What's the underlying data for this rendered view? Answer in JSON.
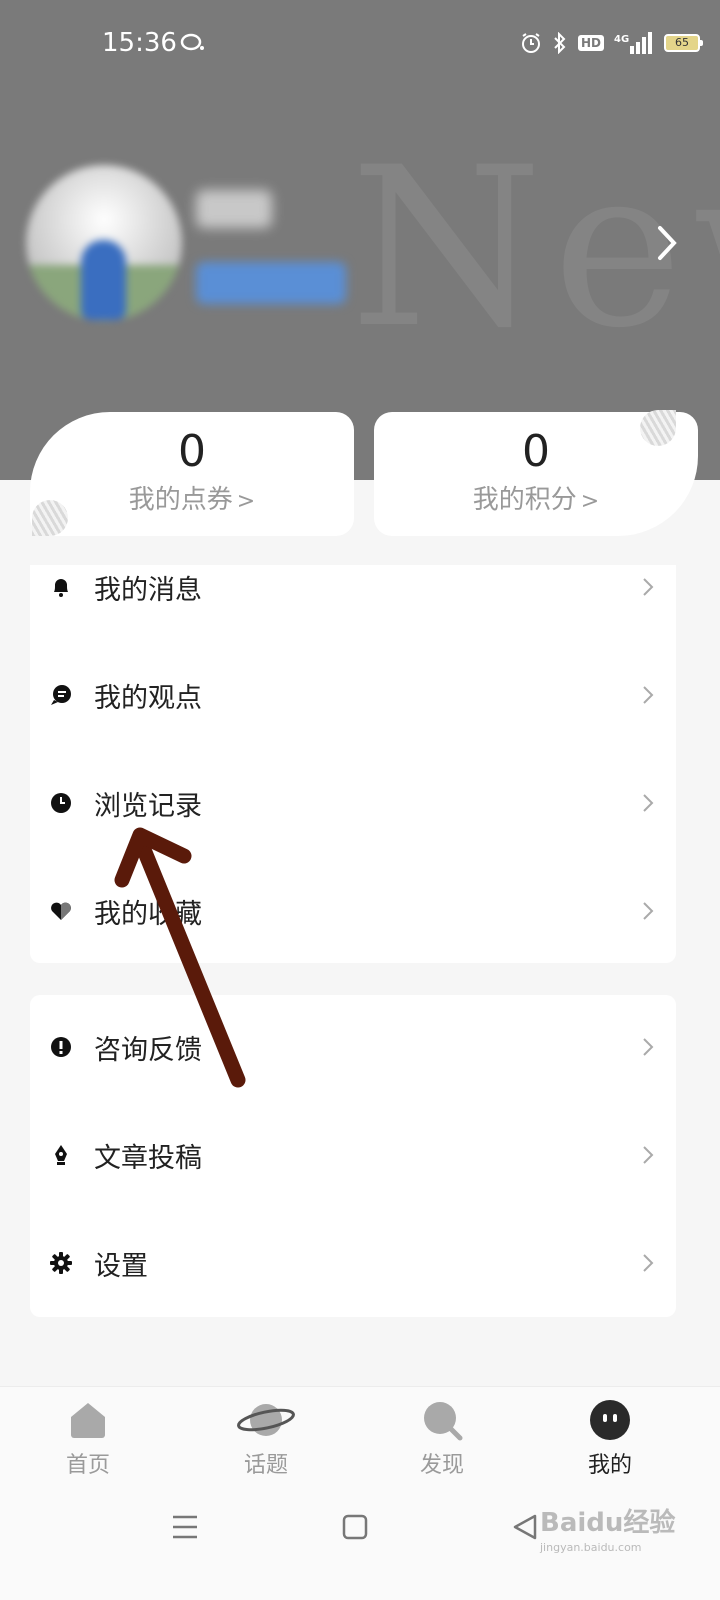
{
  "status_bar": {
    "time": "15:36",
    "icons": [
      "message-bubble-icon",
      "alarm-icon",
      "bluetooth-icon",
      "hd-icon",
      "signal-4g-icon",
      "battery-icon"
    ],
    "hd_label": "HD",
    "network": "4G",
    "battery": "65"
  },
  "header": {
    "background_color": "#7a7a7a",
    "watermark": "New"
  },
  "stats": [
    {
      "value": "0",
      "label": "我的点券"
    },
    {
      "value": "0",
      "label": "我的积分"
    }
  ],
  "menu_group_1": [
    {
      "label": "我的消息",
      "icon": "bell-icon"
    },
    {
      "label": "我的观点",
      "icon": "comment-icon"
    },
    {
      "label": "浏览记录",
      "icon": "clock-icon"
    },
    {
      "label": "我的收藏",
      "icon": "heart-icon"
    }
  ],
  "menu_group_2": [
    {
      "label": "咨询反馈",
      "icon": "exclamation-icon"
    },
    {
      "label": "文章投稿",
      "icon": "pen-nib-icon"
    },
    {
      "label": "设置",
      "icon": "gear-icon"
    }
  ],
  "tabs": [
    {
      "label": "首页",
      "icon": "home-icon",
      "active": false
    },
    {
      "label": "话题",
      "icon": "planet-icon",
      "active": false
    },
    {
      "label": "发现",
      "icon": "search-icon",
      "active": false
    },
    {
      "label": "我的",
      "icon": "profile-face-icon",
      "active": true
    }
  ],
  "nav_bar": [
    "menu-icon",
    "home-square-icon",
    "back-triangle-icon"
  ],
  "watermark": {
    "brand": "Baidu经验",
    "url": "jingyan.baidu.com"
  },
  "annotation": {
    "color": "#5a1a0a",
    "points_to": "浏览记录"
  }
}
